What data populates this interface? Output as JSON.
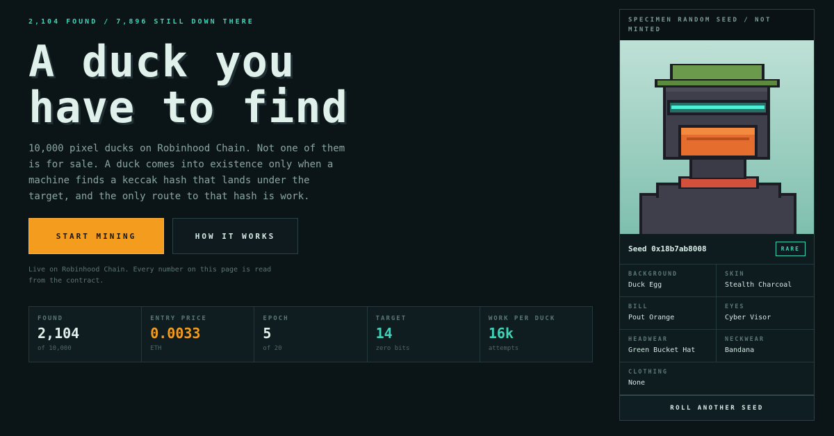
{
  "kicker": "2,104 FOUND / 7,896 STILL DOWN THERE",
  "headline": "A duck you have to find",
  "lede": "10,000 pixel ducks on Robinhood Chain. Not one of them is for sale. A duck comes into existence only when a machine finds a keccak hash that lands under the target, and the only route to that hash is work.",
  "buttons": {
    "primary": "START MINING",
    "secondary": "HOW IT WORKS"
  },
  "note": "Live on Robinhood Chain. Every number on this page is read from the contract.",
  "stats": [
    {
      "label": "FOUND",
      "value": "2,104",
      "sub": "of 10,000"
    },
    {
      "label": "ENTRY PRICE",
      "value": "0.0033",
      "sub": "ETH"
    },
    {
      "label": "EPOCH",
      "value": "5",
      "sub": "of 20"
    },
    {
      "label": "TARGET",
      "value": "14",
      "sub": "zero bits"
    },
    {
      "label": "WORK PER DUCK",
      "value": "16k",
      "sub": "attempts"
    }
  ],
  "card": {
    "header": "SPECIMEN RANDOM SEED / NOT MINTED",
    "seed": "Seed 0x18b7ab8008",
    "badge": "RARE",
    "traits": [
      {
        "label": "BACKGROUND",
        "value": "Duck Egg"
      },
      {
        "label": "SKIN",
        "value": "Stealth Charcoal"
      },
      {
        "label": "BILL",
        "value": "Pout Orange"
      },
      {
        "label": "EYES",
        "value": "Cyber Visor"
      },
      {
        "label": "HEADWEAR",
        "value": "Green Bucket Hat"
      },
      {
        "label": "NECKWEAR",
        "value": "Bandana"
      },
      {
        "label": "CLOTHING",
        "value": "None"
      }
    ],
    "roll": "ROLL ANOTHER SEED"
  },
  "colors": {
    "accent_orange": "#f39c1e",
    "accent_teal": "#3fd3b8",
    "background": "#0b1417"
  }
}
